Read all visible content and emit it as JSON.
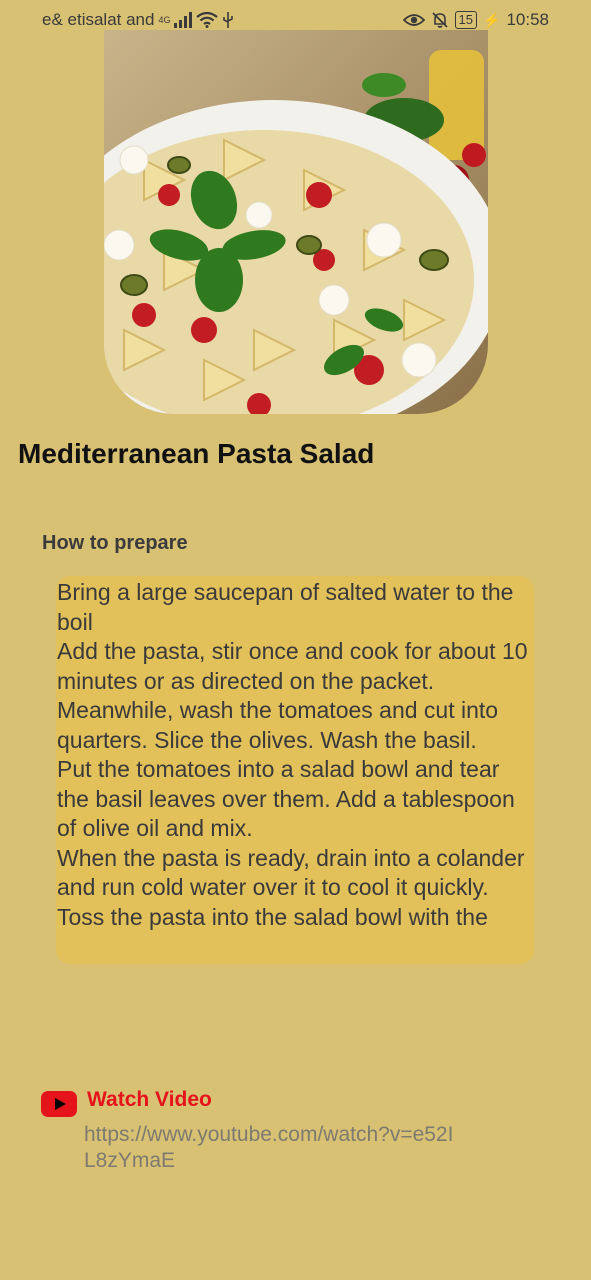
{
  "status_bar": {
    "carrier": "e& etisalat and",
    "network": "4G",
    "battery": "15",
    "time": "10:58"
  },
  "recipe": {
    "title": "Mediterranean Pasta Salad",
    "image_icon": "pasta-salad-photo"
  },
  "preparation": {
    "label": "How to prepare",
    "steps": [
      "Bring a large saucepan of salted water to the boil",
      "Add the pasta, stir once and cook for about 10 minutes or as directed on the packet.",
      "Meanwhile, wash the tomatoes and cut into quarters. Slice the olives. Wash the basil.",
      "Put the tomatoes into a salad bowl and tear the basil leaves over them. Add a tablespoon of olive oil and mix.",
      "When the pasta is ready, drain into a colander and run cold water over it to cool it quickly.",
      "Toss the pasta into the salad bowl with the"
    ]
  },
  "video": {
    "label": "Watch Video",
    "url": "https://www.youtube.com/watch?v=e52IL8zYmaE",
    "icon": "youtube-icon"
  },
  "colors": {
    "background": "#d9c174",
    "steps_box": "#e2c05a",
    "video_red": "#e5131a"
  }
}
